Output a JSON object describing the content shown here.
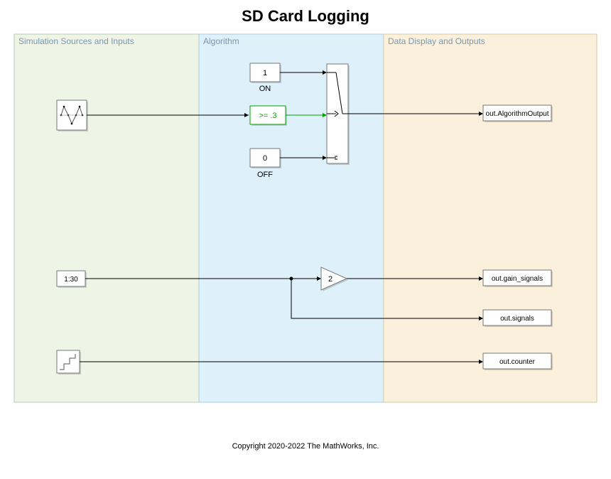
{
  "title": "SD Card Logging",
  "footer": "Copyright 2020-2022 The MathWorks, Inc.",
  "regions": {
    "sources": {
      "label": "Simulation Sources and Inputs",
      "fill": "#eef4e6",
      "stroke": "#b8cbb0"
    },
    "algorithm": {
      "label": "Algorithm",
      "fill": "#def0f9",
      "stroke": "#a9cce0"
    },
    "outputs": {
      "label": "Data Display and Outputs",
      "fill": "#fbf0db",
      "stroke": "#d9c9a3"
    }
  },
  "blocks": {
    "sine": {
      "name": "sine-wave-source"
    },
    "const_on": {
      "value": "1",
      "caption": "ON"
    },
    "const_off": {
      "value": "0",
      "caption": "OFF"
    },
    "compare": {
      "value": ">= .3"
    },
    "ramp_const": {
      "value": "1:30"
    },
    "gain": {
      "value": "2"
    },
    "stair": {
      "name": "counter-source"
    }
  },
  "outputs": {
    "algorithm_output": "out.AlgorithmOutput",
    "gain_signals": "out.gain_signals",
    "signals": "out.signals",
    "counter": "out.counter"
  }
}
